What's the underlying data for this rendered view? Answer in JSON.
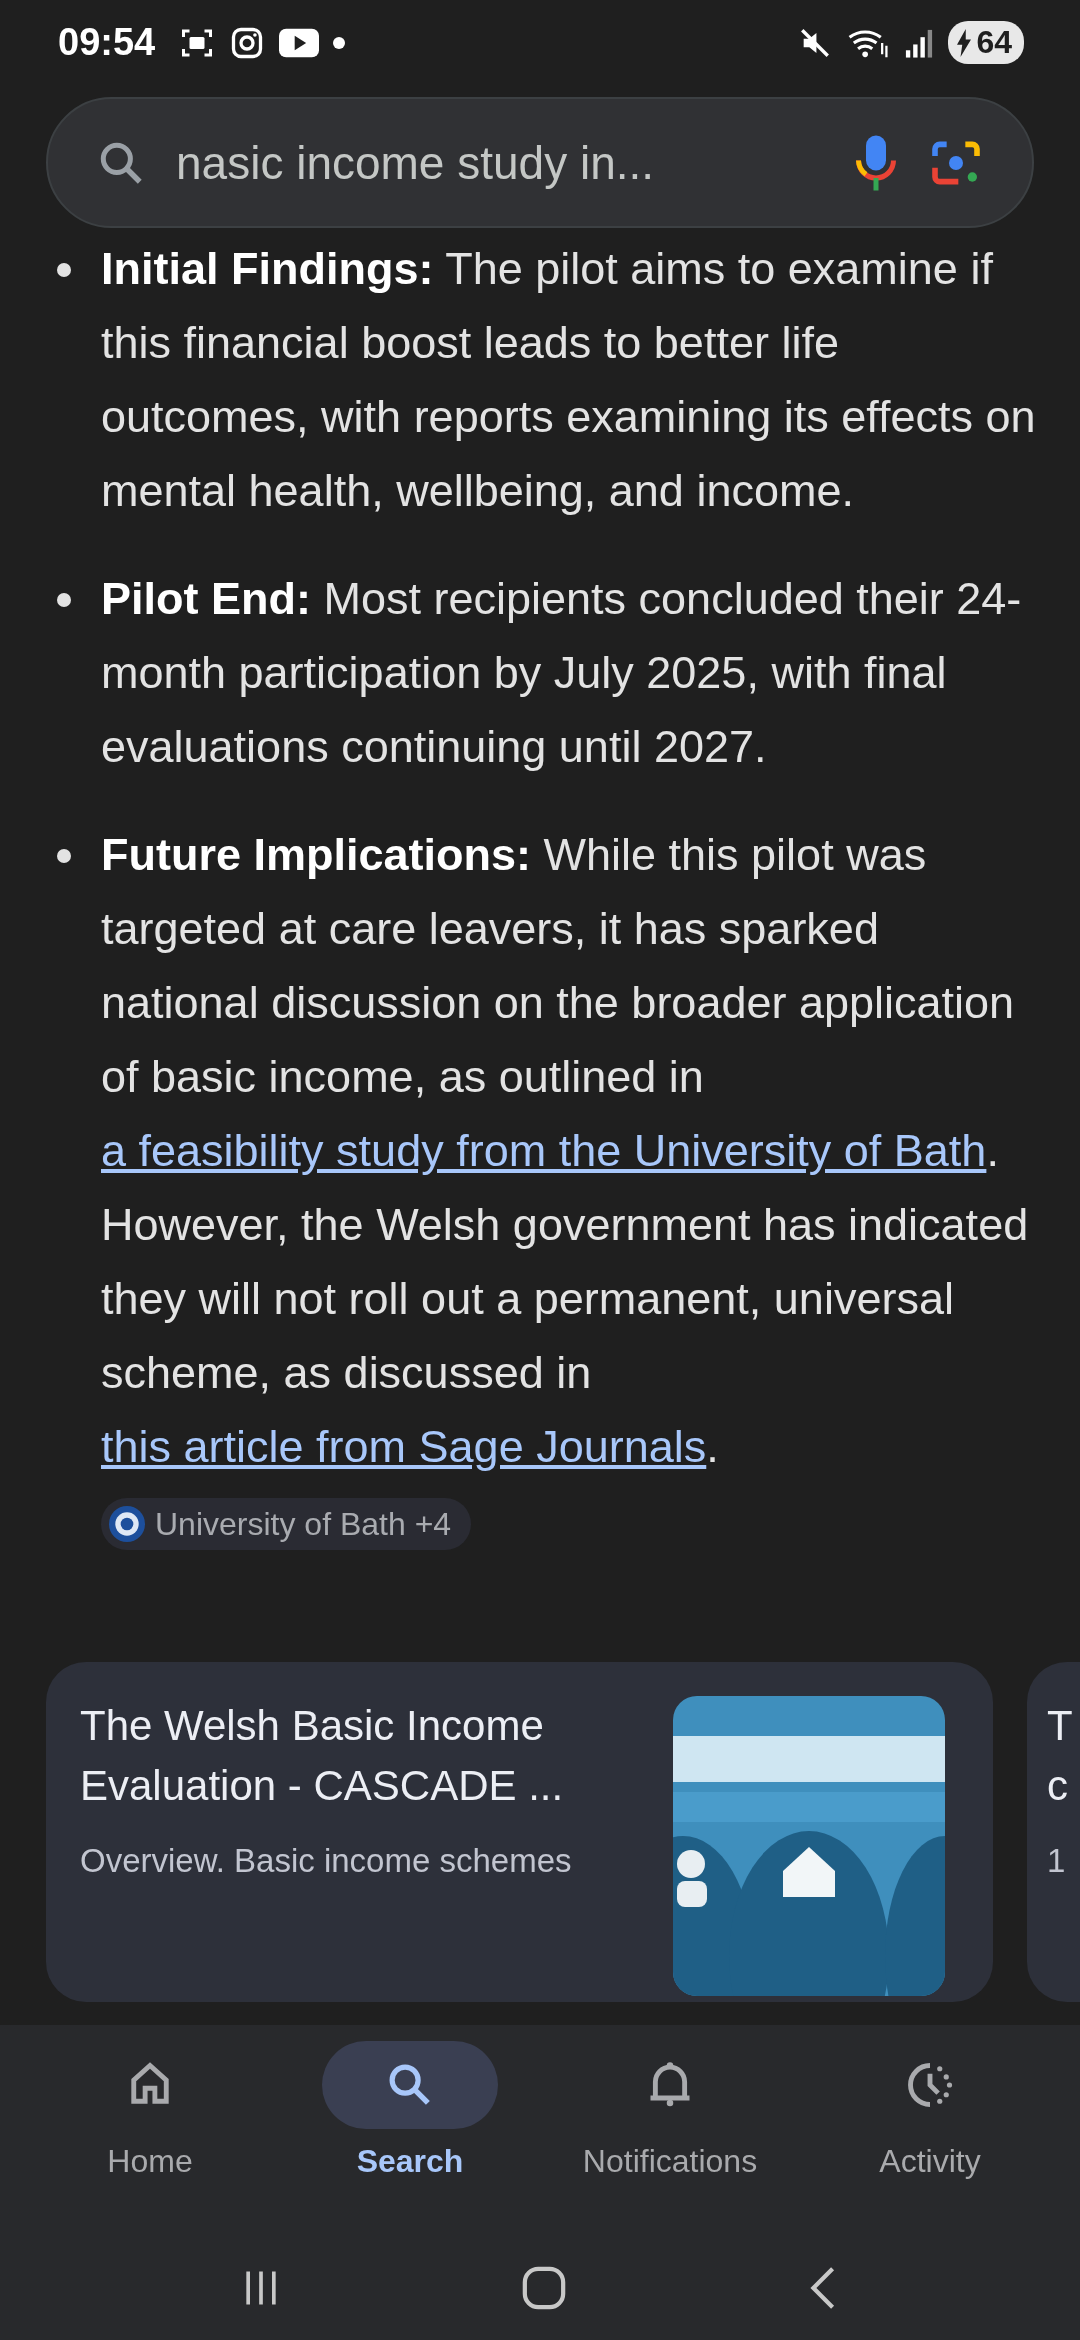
{
  "status_bar": {
    "time": "09:54",
    "battery": "64"
  },
  "search": {
    "value": "nasic income study in..."
  },
  "bullets": [
    {
      "segments": [
        {
          "kind": "bold",
          "text": "Initial Findings:"
        },
        {
          "kind": "plain",
          "text": " The pilot aims to examine if this financial boost leads to better life outcomes, with reports examining its effects on mental health, wellbeing, and income."
        }
      ]
    },
    {
      "segments": [
        {
          "kind": "bold",
          "text": "Pilot End:"
        },
        {
          "kind": "plain",
          "text": " Most recipients concluded their 24-month participation by July 2025, with final evaluations continuing until 2027."
        }
      ]
    },
    {
      "segments": [
        {
          "kind": "bold",
          "text": "Future Implications:"
        },
        {
          "kind": "plain",
          "text": " While this pilot was targeted at care leavers, it has sparked national discussion on the broader application of basic income, as outlined in "
        },
        {
          "kind": "link",
          "text": "a feasibility study from the University of Bath"
        },
        {
          "kind": "plain",
          "text": ". However, the Welsh government has indicated they will not roll out a permanent, universal scheme, as discussed in "
        },
        {
          "kind": "link",
          "text": "this article from Sage Journals"
        },
        {
          "kind": "plain",
          "text": "."
        }
      ]
    }
  ],
  "source_chip": {
    "label": "University of Bath +4"
  },
  "cards": [
    {
      "title": "The Welsh Basic Income Evaluation - CASCADE ...",
      "snippet": "Overview. Basic income schemes"
    },
    {
      "title": "T c",
      "snippet": "1"
    }
  ],
  "nav": [
    {
      "kind": "home",
      "label": "Home",
      "selected": false
    },
    {
      "kind": "search",
      "label": "Search",
      "selected": true
    },
    {
      "kind": "bell",
      "label": "Notifications",
      "selected": false
    },
    {
      "kind": "activity",
      "label": "Activity",
      "selected": false
    }
  ]
}
